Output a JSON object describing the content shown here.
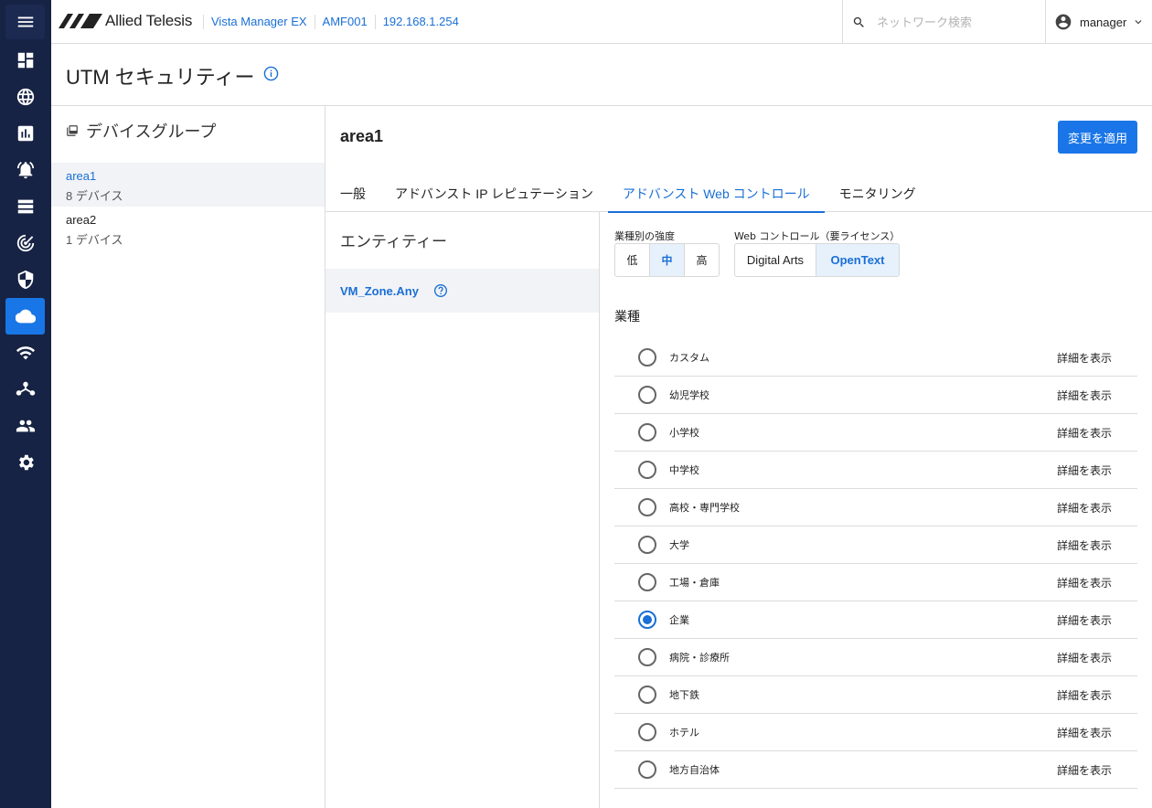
{
  "brand": {
    "name": "Allied Telesis"
  },
  "breadcrumbs": [
    "Vista Manager EX",
    "AMF001",
    "192.168.1.254"
  ],
  "search": {
    "placeholder": "ネットワーク検索"
  },
  "user": {
    "name": "manager"
  },
  "nav": {
    "items": [
      "menu-icon",
      "dashboard-icon",
      "globe-icon",
      "chart-icon",
      "alarm-icon",
      "list-icon",
      "radar-icon",
      "shield-icon",
      "cloud-icon",
      "wifi-icon",
      "topology-icon",
      "users-icon",
      "gear-icon"
    ],
    "active": "cloud-icon"
  },
  "page": {
    "title": "UTM セキュリティー"
  },
  "device_groups": {
    "heading": "デバイスグループ",
    "items": [
      {
        "name": "area1",
        "count": "8 デバイス",
        "selected": true
      },
      {
        "name": "area2",
        "count": "1 デバイス",
        "selected": false
      }
    ]
  },
  "main": {
    "title": "area1",
    "apply_label": "変更を適用",
    "tabs": [
      "一般",
      "アドバンスト IP レピュテーション",
      "アドバンスト Web コントロール",
      "モニタリング"
    ],
    "active_tab": 2
  },
  "entity": {
    "heading": "エンティティー",
    "items": [
      "VM_Zone.Any"
    ]
  },
  "strength": {
    "label": "業種別の強度",
    "options": [
      "低",
      "中",
      "高"
    ],
    "selected": "中"
  },
  "web_control": {
    "label": "Web コントロール（要ライセンス）",
    "options": [
      "Digital Arts",
      "OpenText"
    ],
    "selected": "OpenText"
  },
  "industries": {
    "heading": "業種",
    "detail_label": "詳細を表示",
    "selected": "企業",
    "items": [
      "カスタム",
      "幼児学校",
      "小学校",
      "中学校",
      "高校・専門学校",
      "大学",
      "工場・倉庫",
      "企業",
      "病院・診療所",
      "地下鉄",
      "ホテル",
      "地方自治体"
    ]
  },
  "colors": {
    "accent": "#1a6fd6",
    "rail": "#172344",
    "selected_bg": "#f1f3f6"
  }
}
